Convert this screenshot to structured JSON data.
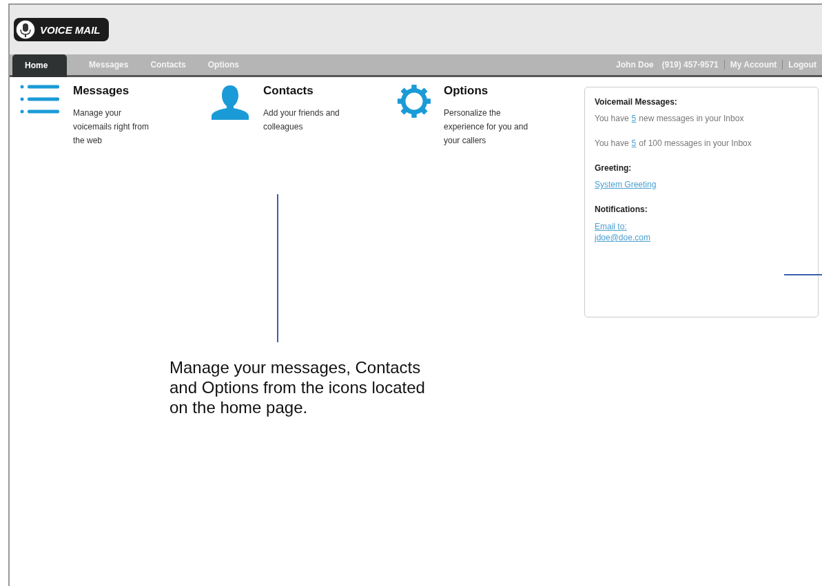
{
  "logo": {
    "text": "VOICE MAIL"
  },
  "nav": {
    "tabs": [
      {
        "label": "Home",
        "selected": true
      },
      {
        "label": "Messages",
        "selected": false
      },
      {
        "label": "Contacts",
        "selected": false
      },
      {
        "label": "Options",
        "selected": false
      }
    ],
    "user_name": "John Doe",
    "phone": "(919) 457-9571",
    "links": [
      "My Account",
      "Logout"
    ]
  },
  "features": [
    {
      "kind": "list",
      "title": "Messages",
      "description": "Manage your voicemails right from the web"
    },
    {
      "kind": "person",
      "title": "Contacts",
      "description": "Add your friends and colleagues"
    },
    {
      "kind": "gear",
      "title": "Options",
      "description": "Personalize the experience for you and your callers"
    }
  ],
  "summary": {
    "voicemail_heading": "Voicemail Messages:",
    "lines": [
      {
        "prefix": "You have",
        "count": "5",
        "suffix": "new messages in your Inbox"
      },
      {
        "prefix": "You have",
        "count": "5",
        "suffix": "of 100 messages in your Inbox"
      }
    ],
    "greeting_heading": "Greeting:",
    "greeting_link": "System Greeting",
    "notifications_heading": "Notifications:",
    "notification_link": "Email to: jdoe@doe.com"
  },
  "annotation": "Manage your messages, Contacts and Options from the icons located on the home page."
}
